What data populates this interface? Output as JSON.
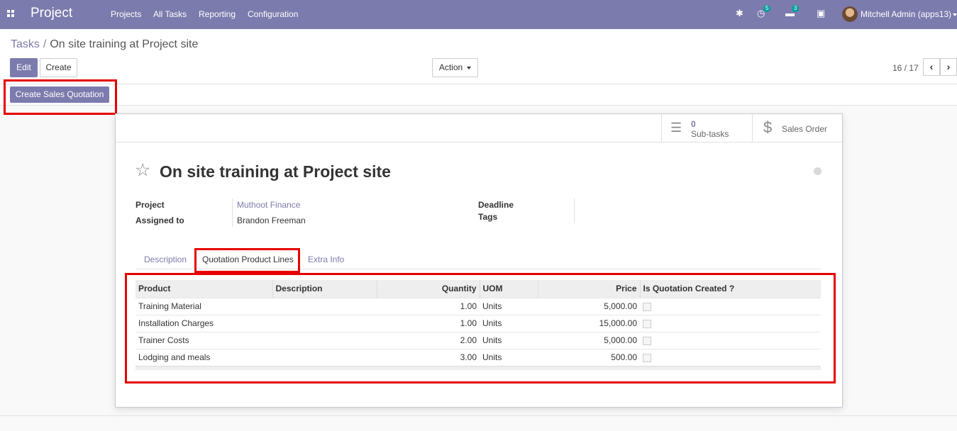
{
  "navbar": {
    "brand": "Project",
    "menu": [
      "Projects",
      "All Tasks",
      "Reporting",
      "Configuration"
    ],
    "activity_count": "5",
    "messages_count": "3",
    "user": "Mitchell Admin (apps13)"
  },
  "breadcrumb": {
    "parent": "Tasks",
    "separator": "/",
    "current": "On site training at Project site"
  },
  "buttons": {
    "edit": "Edit",
    "create": "Create",
    "action": "Action",
    "create_sales_quotation": "Create Sales Quotation"
  },
  "pager": {
    "value": "16 / 17"
  },
  "smart_buttons": {
    "subtasks_count": "0",
    "subtasks_label": "Sub-tasks",
    "sales_order": "Sales Order"
  },
  "task": {
    "title": "On site training at Project site",
    "project_label": "Project",
    "project": "Muthoot Finance",
    "assigned_label": "Assigned to",
    "assigned": "Brandon Freeman",
    "deadline_label": "Deadline",
    "tags_label": "Tags"
  },
  "tabs": [
    "Description",
    "Quotation Product Lines",
    "Extra Info"
  ],
  "table": {
    "headers": [
      "Product",
      "Description",
      "Quantity",
      "UOM",
      "Price",
      "Is Quotation Created ?"
    ],
    "rows": [
      [
        "Training Material",
        "",
        "1.00",
        "Units",
        "5,000.00"
      ],
      [
        "Installation Charges",
        "",
        "1.00",
        "Units",
        "15,000.00"
      ],
      [
        "Trainer Costs",
        "",
        "2.00",
        "Units",
        "5,000.00"
      ],
      [
        "Lodging and meals",
        "",
        "3.00",
        "Units",
        "500.00"
      ]
    ]
  },
  "colors": {
    "brand": "#7c7bad",
    "highlight": "#e60000"
  }
}
